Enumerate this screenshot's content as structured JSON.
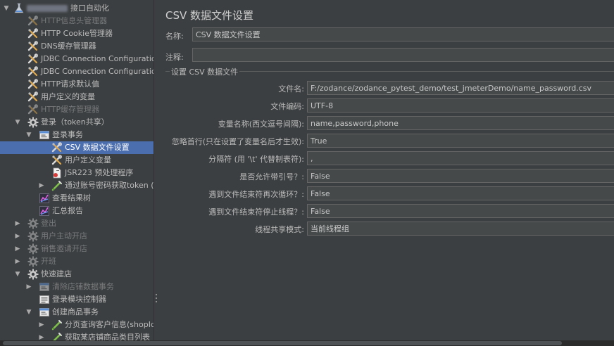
{
  "tree": {
    "items": [
      {
        "label": "接口自动化",
        "level": 0,
        "arrow": "down",
        "icon": "testplan",
        "state": "normal",
        "blurred": true
      },
      {
        "label": "HTTP信息头管理器",
        "level": 1,
        "arrow": "",
        "icon": "config",
        "state": "dim"
      },
      {
        "label": "HTTP Cookie管理器",
        "level": 1,
        "arrow": "",
        "icon": "config",
        "state": "normal"
      },
      {
        "label": "DNS缓存管理器",
        "level": 1,
        "arrow": "",
        "icon": "config",
        "state": "normal"
      },
      {
        "label": "JDBC Connection Configuration",
        "level": 1,
        "arrow": "",
        "icon": "config",
        "state": "normal"
      },
      {
        "label": "JDBC Connection Configuration",
        "level": 1,
        "arrow": "",
        "icon": "config",
        "state": "normal"
      },
      {
        "label": "HTTP请求默认值",
        "level": 1,
        "arrow": "",
        "icon": "config",
        "state": "normal"
      },
      {
        "label": "用户定义的变量",
        "level": 1,
        "arrow": "",
        "icon": "config",
        "state": "normal"
      },
      {
        "label": "HTTP缓存管理器",
        "level": 1,
        "arrow": "",
        "icon": "config",
        "state": "dim"
      },
      {
        "label": "登录（token共享）",
        "level": 1,
        "arrow": "down",
        "icon": "gear",
        "state": "normal"
      },
      {
        "label": "登录事务",
        "level": 2,
        "arrow": "down",
        "icon": "transaction",
        "state": "normal"
      },
      {
        "label": "CSV 数据文件设置",
        "level": 3,
        "arrow": "",
        "icon": "config",
        "state": "selected"
      },
      {
        "label": "用户定义变量",
        "level": 3,
        "arrow": "",
        "icon": "config",
        "state": "normal"
      },
      {
        "label": "JSR223 预处理程序",
        "level": 3,
        "arrow": "",
        "icon": "script",
        "state": "normal"
      },
      {
        "label": "通过账号密码获取token (/",
        "level": 3,
        "arrow": "right",
        "icon": "sampler",
        "state": "normal"
      },
      {
        "label": "查看结果树",
        "level": 2,
        "arrow": "",
        "icon": "listener",
        "state": "normal"
      },
      {
        "label": "汇总报告",
        "level": 2,
        "arrow": "",
        "icon": "listener",
        "state": "normal"
      },
      {
        "label": "登出",
        "level": 1,
        "arrow": "right",
        "icon": "gear",
        "state": "dim"
      },
      {
        "label": "用户主动开店",
        "level": 1,
        "arrow": "right",
        "icon": "gear",
        "state": "dim"
      },
      {
        "label": "销售邀请开店",
        "level": 1,
        "arrow": "right",
        "icon": "gear",
        "state": "dim"
      },
      {
        "label": "开班",
        "level": 1,
        "arrow": "right",
        "icon": "gear",
        "state": "dim"
      },
      {
        "label": "快速建店",
        "level": 1,
        "arrow": "down",
        "icon": "gear",
        "state": "normal"
      },
      {
        "label": "清除店铺数据事务",
        "level": 2,
        "arrow": "right",
        "icon": "transaction",
        "state": "dim"
      },
      {
        "label": "登录模块控制器",
        "level": 2,
        "arrow": "",
        "icon": "module",
        "state": "normal"
      },
      {
        "label": "创建商品事务",
        "level": 2,
        "arrow": "down",
        "icon": "transaction",
        "state": "normal"
      },
      {
        "label": "分页查询客户信息(shopId",
        "level": 3,
        "arrow": "right",
        "icon": "sampler",
        "state": "normal"
      },
      {
        "label": "获取某店铺商品类目列表",
        "level": 3,
        "arrow": "right",
        "icon": "sampler",
        "state": "normal"
      }
    ]
  },
  "panel": {
    "title": "CSV 数据文件设置",
    "name_label": "名称:",
    "name_value": "CSV 数据文件设置",
    "comment_label": "注释:",
    "comment_value": "",
    "group_title": "设置 CSV 数据文件",
    "fields": [
      {
        "label": "文件名:",
        "value": "F:/zodance/zodance_pytest_demo/test_jmeterDemo/name_password.csv",
        "type": "text"
      },
      {
        "label": "文件编码:",
        "value": "UTF-8",
        "type": "combo"
      },
      {
        "label": "变量名称(西文逗号间隔):",
        "value": "name,password,phone",
        "type": "text"
      },
      {
        "label": "忽略首行(只在设置了变量名后才生效):",
        "value": "True",
        "type": "combo"
      },
      {
        "label": "分隔符 (用 '\\t' 代替制表符):",
        "value": ",",
        "type": "text"
      },
      {
        "label": "是否允许带引号？:",
        "value": "False",
        "type": "combo"
      },
      {
        "label": "遇到文件结束符再次循环？:",
        "value": "False",
        "type": "combo"
      },
      {
        "label": "遇到文件结束符停止线程？:",
        "value": "False",
        "type": "combo"
      },
      {
        "label": "线程共享模式:",
        "value": "当前线程组",
        "type": "combo"
      }
    ]
  },
  "colors": {
    "background": "#3c3f41",
    "selection": "#4b6eaf",
    "field_bg": "#45494a",
    "field_border": "#646464",
    "text": "#bbbbbb",
    "dim_text": "#77797b"
  }
}
